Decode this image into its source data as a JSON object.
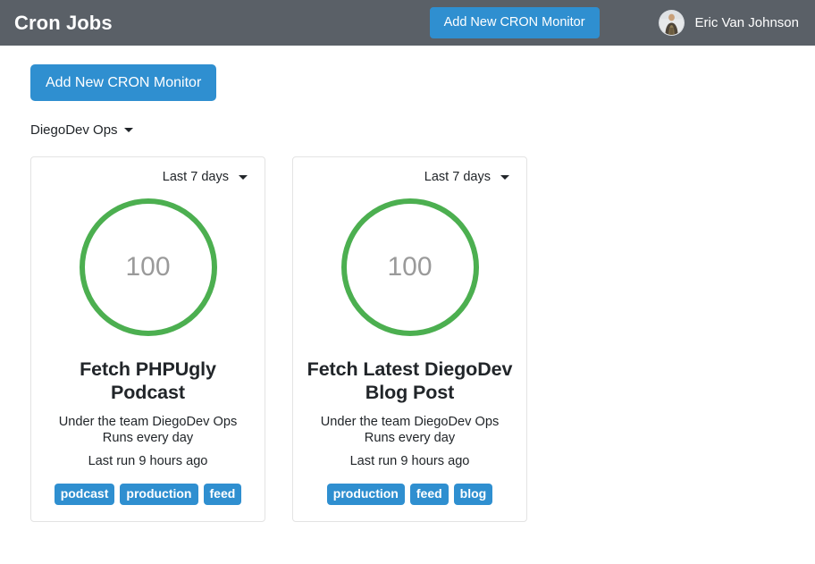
{
  "header": {
    "brand": "Cron Jobs",
    "add_button_label": "Add New CRON Monitor",
    "user_name": "Eric Van Johnson",
    "avatar_icon": "user-photo-avatar",
    "bg_color": "#5a6067",
    "accent_color": "#2f8fd0"
  },
  "toolbar": {
    "add_button_label": "Add New CRON Monitor",
    "team_label": "DiegoDev Ops",
    "team_caret_icon": "caret-down-icon"
  },
  "cards": [
    {
      "range_label": "Last 7 days",
      "range_caret_icon": "caret-down-icon",
      "gauge": {
        "value": "100",
        "percent": 100,
        "color": "#4caf50",
        "track_color": "#ffffff"
      },
      "title": "Fetch PHPUgly Podcast",
      "team_line": "Under the team DiegoDev Ops",
      "schedule_line": "Runs every day",
      "last_run": "Last run 9 hours ago",
      "tags": [
        "podcast",
        "production",
        "feed"
      ]
    },
    {
      "range_label": "Last 7 days",
      "range_caret_icon": "caret-down-icon",
      "gauge": {
        "value": "100",
        "percent": 100,
        "color": "#4caf50",
        "track_color": "#ffffff"
      },
      "title": "Fetch Latest DiegoDev Blog Post",
      "team_line": "Under the team DiegoDev Ops",
      "schedule_line": "Runs every day",
      "last_run": "Last run 9 hours ago",
      "tags": [
        "production",
        "feed",
        "blog"
      ]
    }
  ]
}
